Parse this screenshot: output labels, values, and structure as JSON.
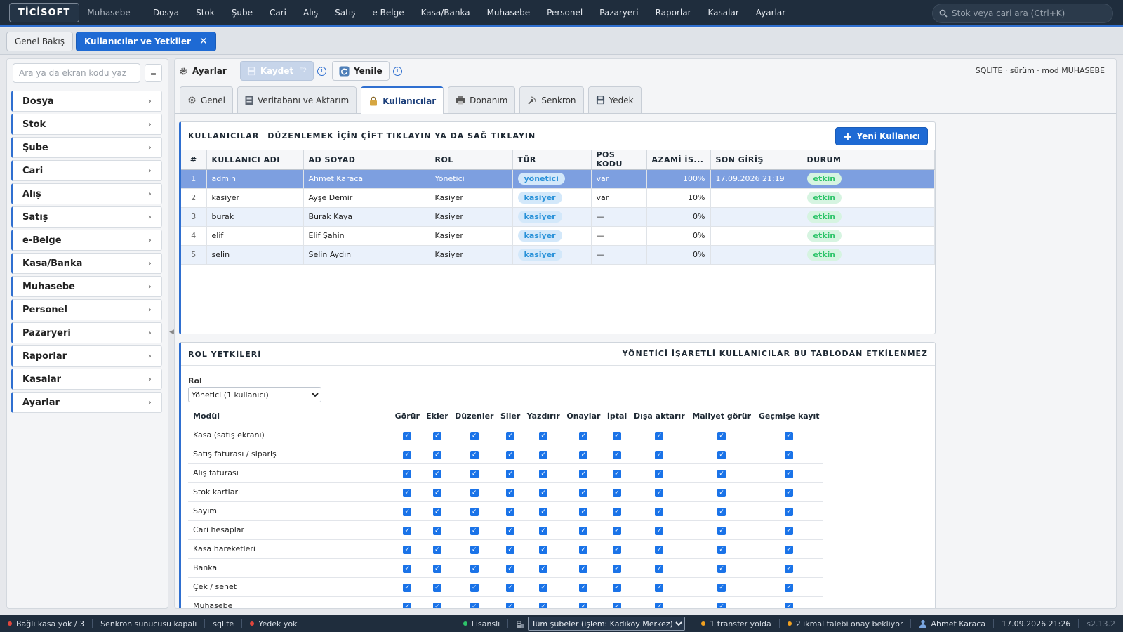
{
  "app": {
    "logo": "TİCİSOFT",
    "subtitle": "Muhasebe",
    "search_placeholder": "Stok veya cari ara (Ctrl+K)"
  },
  "top_menu": [
    "Dosya",
    "Stok",
    "Şube",
    "Cari",
    "Alış",
    "Satış",
    "e-Belge",
    "Kasa/Banka",
    "Muhasebe",
    "Personel",
    "Pazaryeri",
    "Raporlar",
    "Kasalar",
    "Ayarlar"
  ],
  "doc_tabs": [
    {
      "label": "Genel Bakış",
      "active": false
    },
    {
      "label": "Kullanıcılar ve Yetkiler",
      "active": true
    }
  ],
  "doc_tab_close": "✕",
  "sidebar": {
    "search_placeholder": "Ara ya da ekran kodu yaz",
    "menu_icon": "≡",
    "items": [
      "Dosya",
      "Stok",
      "Şube",
      "Cari",
      "Alış",
      "Satış",
      "e-Belge",
      "Kasa/Banka",
      "Muhasebe",
      "Personel",
      "Pazaryeri",
      "Raporlar",
      "Kasalar",
      "Ayarlar"
    ],
    "chevron": "›"
  },
  "toolbar": {
    "title": "Ayarlar",
    "save_label": "Kaydet",
    "save_shortcut": "F2",
    "refresh_label": "Yenile",
    "info_glyph": "i",
    "sysinfo": "SQLITE · sürüm · mod MUHASEBE"
  },
  "subtabs": [
    {
      "label": "Genel",
      "icon": "gear-icon",
      "active": false
    },
    {
      "label": "Veritabanı ve Aktarım",
      "icon": "database-icon",
      "active": false
    },
    {
      "label": "Kullanıcılar",
      "icon": "users-lock-icon",
      "active": true
    },
    {
      "label": "Donanım",
      "icon": "printer-icon",
      "active": false
    },
    {
      "label": "Senkron",
      "icon": "satellite-icon",
      "active": false
    },
    {
      "label": "Yedek",
      "icon": "floppy-icon",
      "active": false
    }
  ],
  "users_panel": {
    "title": "KULLANICILAR",
    "hint": "DÜZENLEMEK İÇİN ÇİFT TIKLAYIN YA DA SAĞ TIKLAYIN",
    "new_button": "Yeni Kullanıcı",
    "columns": [
      "#",
      "KULLANICI ADI",
      "AD SOYAD",
      "ROL",
      "TÜR",
      "POS KODU",
      "AZAMİ İS...",
      "SON GİRİŞ",
      "DURUM"
    ],
    "rows": [
      {
        "no": "1",
        "username": "admin",
        "fullname": "Ahmet Karaca",
        "role": "Yönetici",
        "type": "yönetici",
        "pos": "var",
        "max": "100%",
        "last_login": "17.09.2026 21:19",
        "status": "etkin",
        "selected": true
      },
      {
        "no": "2",
        "username": "kasiyer",
        "fullname": "Ayşe Demir",
        "role": "Kasiyer",
        "type": "kasiyer",
        "pos": "var",
        "max": "10%",
        "last_login": "",
        "status": "etkin",
        "selected": false
      },
      {
        "no": "3",
        "username": "burak",
        "fullname": "Burak Kaya",
        "role": "Kasiyer",
        "type": "kasiyer",
        "pos": "—",
        "max": "0%",
        "last_login": "",
        "status": "etkin",
        "selected": false
      },
      {
        "no": "4",
        "username": "elif",
        "fullname": "Elif Şahin",
        "role": "Kasiyer",
        "type": "kasiyer",
        "pos": "—",
        "max": "0%",
        "last_login": "",
        "status": "etkin",
        "selected": false
      },
      {
        "no": "5",
        "username": "selin",
        "fullname": "Selin Aydın",
        "role": "Kasiyer",
        "type": "kasiyer",
        "pos": "—",
        "max": "0%",
        "last_login": "",
        "status": "etkin",
        "selected": false
      }
    ]
  },
  "roles_panel": {
    "title": "ROL YETKİLERİ",
    "note": "YÖNETİCİ İŞARETLİ KULLANICILAR BU TABLODAN ETKİLENMEZ",
    "role_label": "Rol",
    "role_selected": "Yönetici (1 kullanıcı)",
    "module_header": "Modül",
    "perm_columns": [
      "Görür",
      "Ekler",
      "Düzenler",
      "Siler",
      "Yazdırır",
      "Onaylar",
      "İptal",
      "Dışa aktarır",
      "Maliyet görür",
      "Geçmişe kayıt"
    ],
    "modules": [
      "Kasa (satış ekranı)",
      "Satış faturası / sipariş",
      "Alış faturası",
      "Stok kartları",
      "Sayım",
      "Cari hesaplar",
      "Kasa hareketleri",
      "Banka",
      "Çek / senet",
      "Muhasebe"
    ],
    "all_checked": true
  },
  "statusbar": {
    "register": "Bağlı kasa yok / 3",
    "sync": "Senkron sunucusu kapalı",
    "db": "sqlite",
    "backup": "Yedek yok",
    "license": "Lisanslı",
    "branch_select": "Tüm şubeler (işlem: Kadıköy Merkez)",
    "transfer": "1 transfer yolda",
    "restock": "2 ikmal talebi onay bekliyor",
    "user": "Ahmet Karaca",
    "datetime": "17.09.2026 21:26",
    "version": "s2.13.2"
  },
  "colors": {
    "accent": "#1e6ad4",
    "topbar": "#1f2d3d",
    "selected_row": "#7d9fe0",
    "status_green": "#2ec46a",
    "status_red": "#e0463c",
    "status_orange": "#f0a020"
  }
}
